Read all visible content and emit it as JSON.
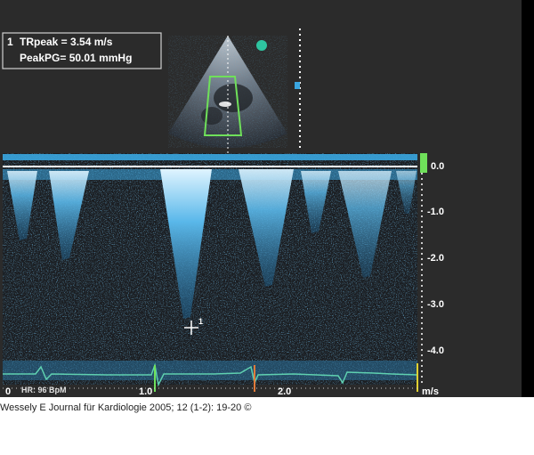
{
  "measurements": {
    "index": "1",
    "tr_peak": "TRpeak = 3.54 m/s",
    "peak_pg": "PeakPG= 50.01 mmHg"
  },
  "velocity_scale": [
    "0.0",
    "-1.0",
    "-2.0",
    "-3.0",
    "-4.0"
  ],
  "time_axis": {
    "labels": [
      "0",
      "1.0",
      "2.0"
    ],
    "unit": "m/s"
  },
  "cursor_marker": "1",
  "heart_rate": "HR: 96 BpM",
  "caption": "Wessely E Journal für Kardiologie 2005; 12 (1-2): 19-20 ©",
  "colors": {
    "doppler": "#3aa6e0",
    "ecg": "#5fd0b0",
    "sector_box": "#6fe05a",
    "marker": "#2ec4a0"
  }
}
